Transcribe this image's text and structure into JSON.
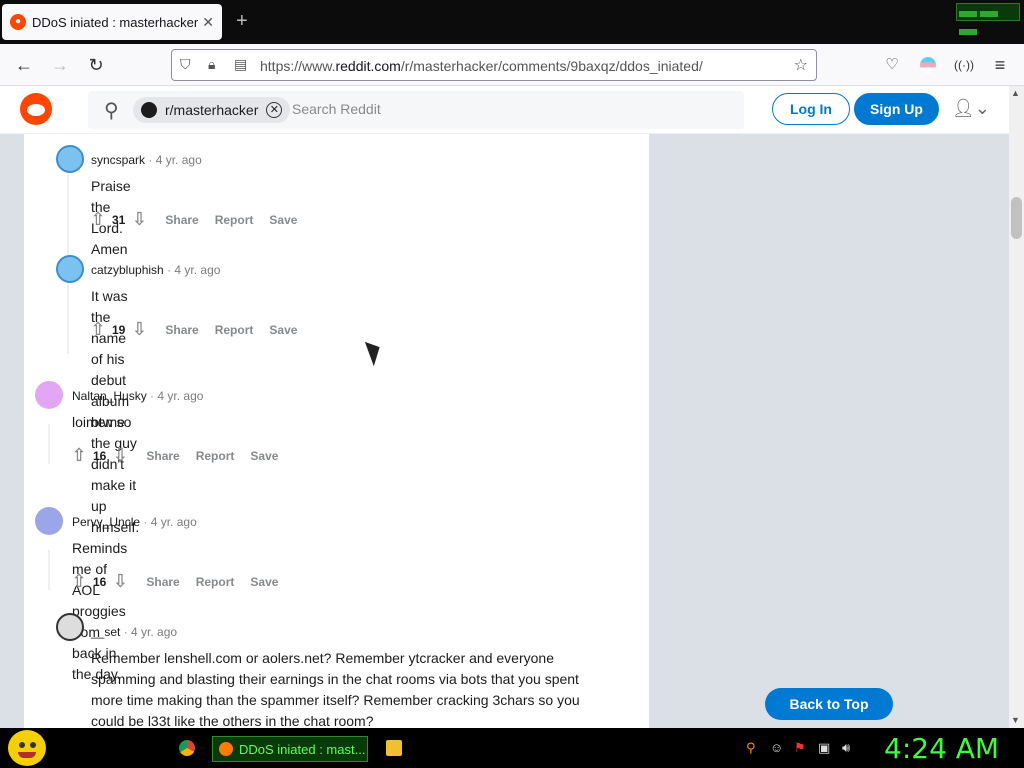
{
  "browser": {
    "tab_title": "DDoS iniated : masterhacker",
    "tab_close": "✕",
    "new_tab": "+",
    "url_prefix": "https://www.",
    "url_domain": "reddit.com",
    "url_path": "/r/masterhacker/comments/9baxqz/ddos_iniated/"
  },
  "reddit": {
    "subreddit_chip": "r/masterhacker",
    "search_placeholder": "Search Reddit",
    "login_label": "Log In",
    "signup_label": "Sign Up"
  },
  "comments": [
    {
      "user": "syncspark",
      "age": "4 yr. ago",
      "body": "Praise the Lord. Amen",
      "score": "31"
    },
    {
      "user": "catzybluphish",
      "age": "4 yr. ago",
      "body": "It was the name of his debut album btw so the guy didn't make it up himself.",
      "score": "19"
    },
    {
      "user": "Naltan_Husky",
      "age": "4 yr. ago",
      "body": "loimeme",
      "score": "16"
    },
    {
      "user": "Pervy_Uncle",
      "age": "4 yr. ago",
      "body": "Reminds me of AOL proggies from back in the day.",
      "score": "16"
    },
    {
      "user": "__set",
      "age": "4 yr. ago",
      "body": "Remember lenshell.com or aolers.net? Remember ytcracker and everyone spamming and blasting their earnings in the chat rooms via bots that you spent more time making than the spammer itself? Remember cracking 3chars so you could be l33t like the others in the chat room?"
    }
  ],
  "actions": {
    "share": "Share",
    "report": "Report",
    "save": "Save",
    "separator": "·"
  },
  "back_to_top": "Back to Top",
  "taskbar": {
    "task_label": "DDoS iniated : mast...",
    "clock": "4:24 AM"
  },
  "colors": {
    "reddit_orange": "#ff4500",
    "reddit_blue": "#0079d3",
    "clock_green": "#3cff3c"
  }
}
